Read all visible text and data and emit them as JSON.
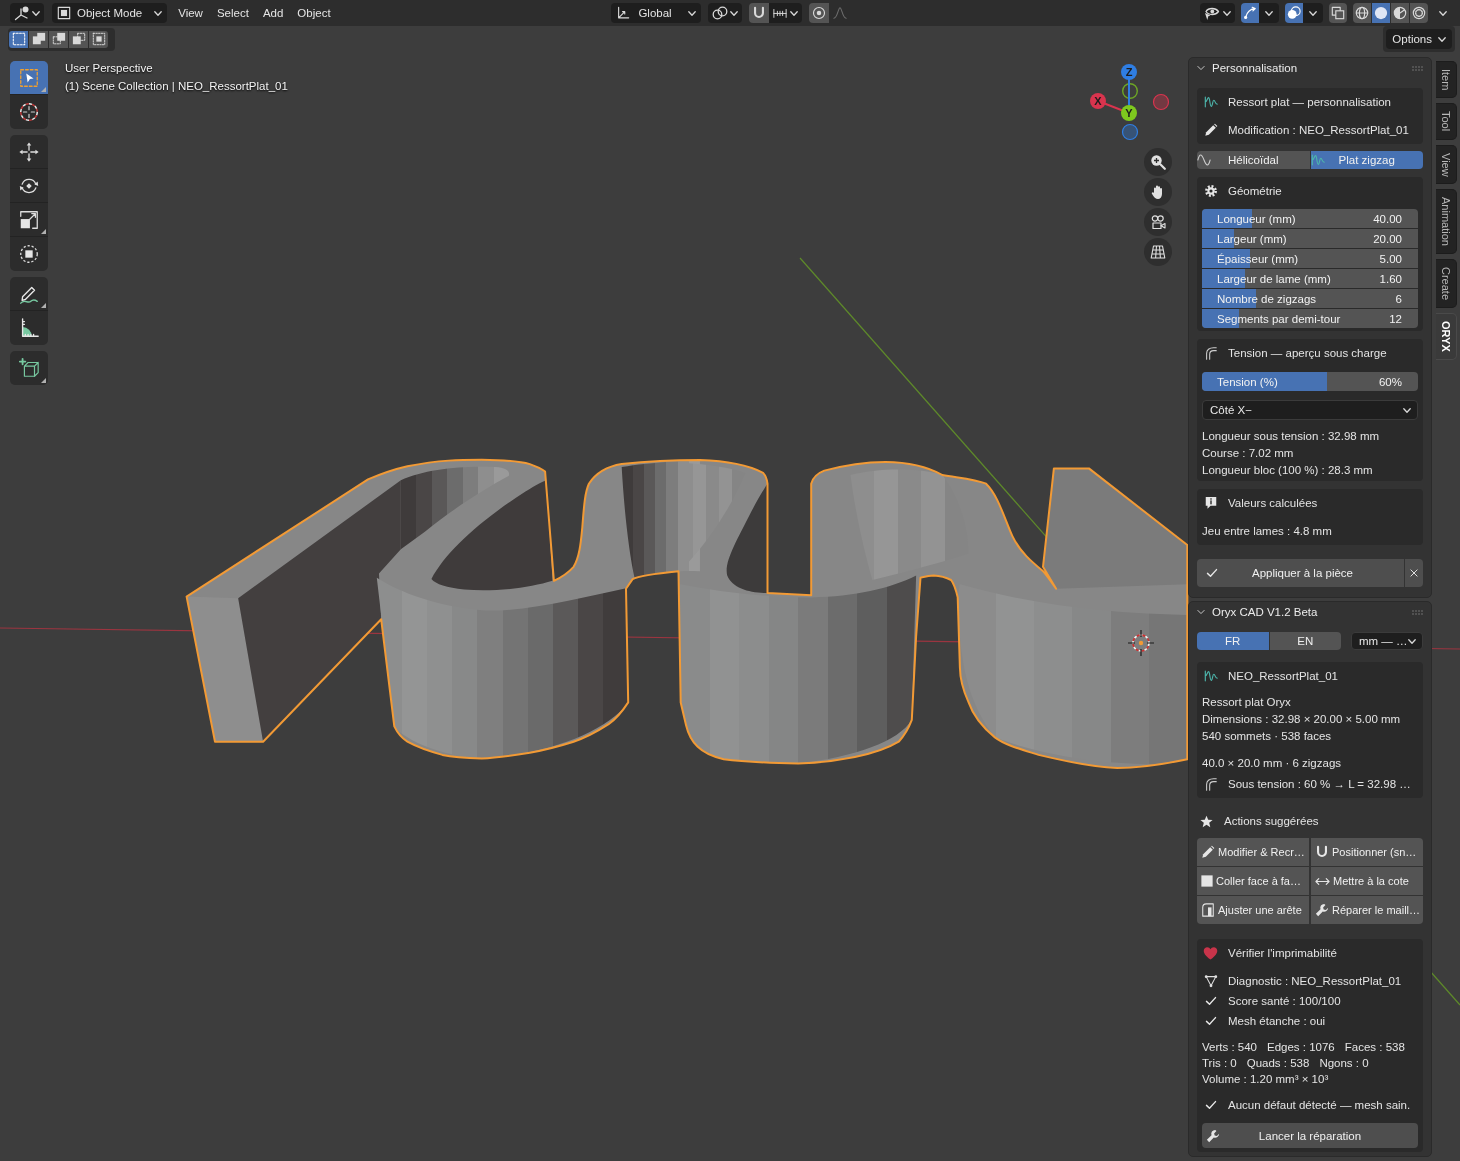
{
  "header": {
    "mode": "Object Mode",
    "menus": [
      "View",
      "Select",
      "Add",
      "Object"
    ],
    "orientation": "Global",
    "toggles": [
      {
        "kind": "gizmos",
        "on": true
      },
      {
        "kind": "overlays",
        "on": true
      },
      {
        "kind": "xray",
        "on": false
      }
    ],
    "shading": [
      {
        "kind": "wireframe",
        "selected": false
      },
      {
        "kind": "solid",
        "selected": true
      },
      {
        "kind": "material",
        "selected": false
      },
      {
        "kind": "rendered",
        "selected": false
      }
    ]
  },
  "tool_header": {
    "select_modes": [
      {
        "kind": "set",
        "selected": true
      },
      {
        "kind": "extend",
        "selected": false
      },
      {
        "kind": "subtract",
        "selected": false
      },
      {
        "kind": "invert",
        "selected": false
      },
      {
        "kind": "intersect",
        "selected": false
      }
    ],
    "options": "Options"
  },
  "toolbar": {
    "groups": [
      [
        {
          "kind": "select_box",
          "selected": true
        },
        {
          "kind": "cursor",
          "selected": false
        }
      ],
      [
        {
          "kind": "move",
          "selected": false
        },
        {
          "kind": "rotate",
          "selected": false
        },
        {
          "kind": "scale",
          "selected": false
        },
        {
          "kind": "transform",
          "selected": false
        }
      ],
      [
        {
          "kind": "annotate",
          "selected": false
        },
        {
          "kind": "measure",
          "selected": false
        }
      ],
      [
        {
          "kind": "add_cube",
          "selected": false
        }
      ]
    ]
  },
  "viewport": {
    "view_name": "User Perspective",
    "collection": "(1) Scene Collection | NEO_RessortPlat_01",
    "axes": [
      {
        "label": "Z",
        "color": "#2f7ee3"
      },
      {
        "label": "X",
        "color": "#d9344e"
      },
      {
        "label": "Y",
        "color": "#7ec91e"
      }
    ]
  },
  "sidebar": {
    "tabs": [
      {
        "label": "Item",
        "selected": false
      },
      {
        "label": "Tool",
        "selected": false
      },
      {
        "label": "View",
        "selected": false
      },
      {
        "label": "Animation",
        "selected": false
      },
      {
        "label": "Create",
        "selected": false
      },
      {
        "label": "ORYX",
        "selected": true
      }
    ],
    "customization": {
      "title": "Personnalisation",
      "expanded": true,
      "info": [
        {
          "kind": "wave",
          "text": "Ressort plat — personnalisation"
        },
        {
          "kind": "pencil",
          "text": "Modification : NEO_RessortPlat_01"
        }
      ],
      "spring_types": [
        {
          "kind": "helical",
          "label": "Hélicoïdal",
          "selected": false
        },
        {
          "kind": "zigzag",
          "label": "Plat zigzag",
          "selected": true
        }
      ],
      "geometry": {
        "title": "Géométrie",
        "fields": [
          {
            "label": "Longueur (mm)",
            "value": "40.00",
            "level": 0.23
          },
          {
            "label": "Largeur (mm)",
            "value": "20.00",
            "level": 0.15
          },
          {
            "label": "Épaisseur (mm)",
            "value": "5.00",
            "level": 0.22
          },
          {
            "label": "Largeur de lame (mm)",
            "value": "1.60",
            "level": 0.2
          },
          {
            "label": "Nombre de zigzags",
            "value": "6",
            "level": 0.25
          },
          {
            "label": "Segments par demi-tour",
            "value": "12",
            "level": 0.17
          }
        ]
      },
      "tension": {
        "title": "Tension — aperçu sous charge",
        "slider": {
          "label": "Tension (%)",
          "value": "60%",
          "level": 0.58
        },
        "side": "Côté X−",
        "lines": [
          "Longueur sous tension : 32.98 mm",
          "Course : 7.02 mm",
          "Longueur bloc (100 %) : 28.3 mm"
        ]
      },
      "computed": {
        "title": "Valeurs calculées",
        "lines": [
          "Jeu entre lames : 4.8 mm"
        ]
      },
      "apply": "Appliquer à la pièce"
    },
    "oryx": {
      "title": "Oryx CAD V1.2 Beta",
      "expanded": true,
      "languages": [
        {
          "label": "FR",
          "selected": true
        },
        {
          "label": "EN",
          "selected": false
        }
      ],
      "units": "mm — …",
      "object": {
        "name": "NEO_RessortPlat_01",
        "lines": [
          "Ressort plat Oryx",
          "Dimensions : 32.98 × 20.00 × 5.00 mm",
          "540 sommets · 538 faces"
        ],
        "summary": "40.0 × 20.0 mm · 6 zigzags",
        "tension": "Sous tension : 60 % → L = 32.98 …"
      },
      "actions_title": "Actions suggérées",
      "actions": [
        {
          "kind": "edit",
          "label": "Modifier & Recr…"
        },
        {
          "kind": "snap",
          "label": "Positionner (sn…"
        },
        {
          "kind": "face",
          "label": "Coller face à fa…"
        },
        {
          "kind": "dimension",
          "label": "Mettre à la cote"
        },
        {
          "kind": "edge",
          "label": "Ajuster une arête"
        },
        {
          "kind": "repair",
          "label": "Réparer le maill…"
        }
      ],
      "printability": {
        "title": "Vérifier l'imprimabilité",
        "diagnostic": "Diagnostic : NEO_RessortPlat_01",
        "checks": [
          "Score santé : 100/100",
          "Mesh étanche : oui"
        ],
        "stats": [
          [
            "Verts : 540",
            "Edges : 1076",
            "Faces : 538"
          ],
          [
            "Tris : 0",
            "Quads : 538",
            "Ngons : 0"
          ],
          [
            "Volume : 1.20 mm³ × 10³"
          ]
        ],
        "verdict": "Aucun défaut détecté — mesh sain.",
        "repair": "Lancer la réparation"
      }
    }
  }
}
